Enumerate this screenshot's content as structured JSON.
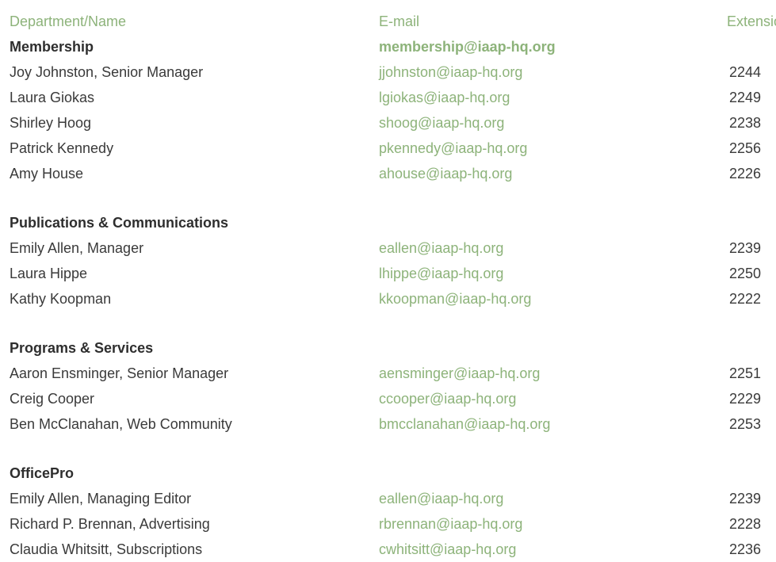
{
  "header": {
    "name": "Department/Name",
    "email": "E-mail",
    "ext": "Extension"
  },
  "departments": [
    {
      "title": "Membership",
      "email": "membership@iaap-hq.org",
      "people": [
        {
          "name": "Joy Johnston, Senior Manager",
          "email": "jjohnston@iaap-hq.org",
          "ext": "2244"
        },
        {
          "name": "Laura Giokas",
          "email": "lgiokas@iaap-hq.org",
          "ext": "2249"
        },
        {
          "name": "Shirley Hoog",
          "email": "shoog@iaap-hq.org",
          "ext": "2238"
        },
        {
          "name": "Patrick Kennedy",
          "email": "pkennedy@iaap-hq.org",
          "ext": "2256"
        },
        {
          "name": "Amy House",
          "email": "ahouse@iaap-hq.org",
          "ext": "2226"
        }
      ]
    },
    {
      "title": "Publications & Communications",
      "email": "",
      "people": [
        {
          "name": "Emily Allen, Manager",
          "email": "eallen@iaap-hq.org",
          "ext": "2239"
        },
        {
          "name": "Laura Hippe",
          "email": "lhippe@iaap-hq.org",
          "ext": "2250"
        },
        {
          "name": "Kathy Koopman",
          "email": "kkoopman@iaap-hq.org",
          "ext": "2222"
        }
      ]
    },
    {
      "title": "Programs & Services",
      "email": "",
      "people": [
        {
          "name": "Aaron Ensminger, Senior Manager",
          "email": "aensminger@iaap-hq.org",
          "ext": "2251"
        },
        {
          "name": "Creig Cooper",
          "email": "ccooper@iaap-hq.org",
          "ext": "2229"
        },
        {
          "name": "Ben McClanahan, Web Community",
          "email": "bmcclanahan@iaap-hq.org",
          "ext": "2253"
        }
      ]
    },
    {
      "title": "OfficePro",
      "email": "",
      "people": [
        {
          "name": "Emily Allen, Managing Editor",
          "email": "eallen@iaap-hq.org",
          "ext": "2239"
        },
        {
          "name": "Richard P. Brennan, Advertising",
          "email": "rbrennan@iaap-hq.org",
          "ext": "2228"
        },
        {
          "name": "Claudia Whitsitt, Subscriptions",
          "email": "cwhitsitt@iaap-hq.org",
          "ext": "2236"
        }
      ]
    }
  ],
  "colors": {
    "accent_green": "#8db37a",
    "text_dark": "#3a3a3a"
  }
}
